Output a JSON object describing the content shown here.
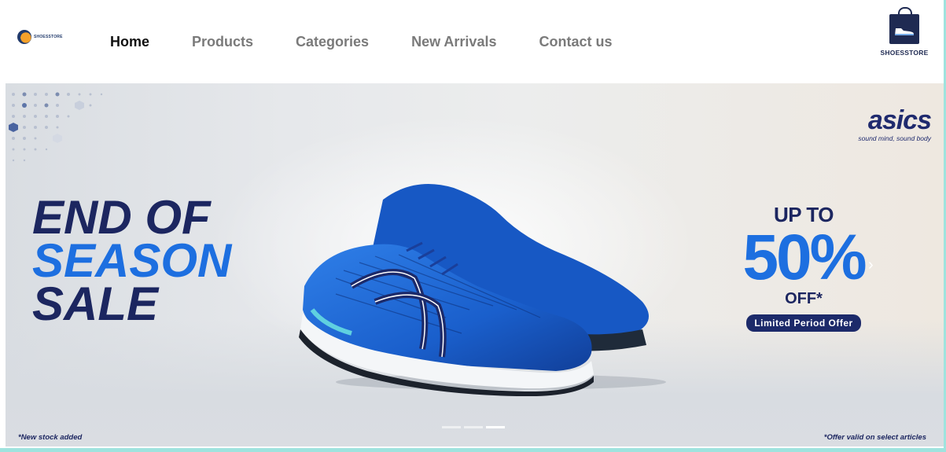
{
  "header": {
    "brand_small": "SHOESSTORE",
    "brand_right": "SHOESSTORE",
    "nav": [
      {
        "label": "Home",
        "active": true
      },
      {
        "label": "Products",
        "active": false
      },
      {
        "label": "Categories",
        "active": false
      },
      {
        "label": "New Arrivals",
        "active": false
      },
      {
        "label": "Contact us",
        "active": false
      }
    ]
  },
  "banner": {
    "headline_line1": "END OF",
    "headline_line2": "SEASON",
    "headline_line3": "SALE",
    "brand_name": "asics",
    "brand_tagline": "sound mind, sound body",
    "offer_upto": "UP TO",
    "offer_percent": "50%",
    "offer_off": "OFF*",
    "offer_pill": "Limited Period Offer",
    "fine_left": "*New stock added",
    "fine_right": "*Offer valid on select articles",
    "slides_total": 3,
    "slide_active": 3,
    "next_arrow": "›"
  },
  "colors": {
    "navy": "#1c2660",
    "blue": "#1d6fe0",
    "frame": "#9fe3de"
  }
}
